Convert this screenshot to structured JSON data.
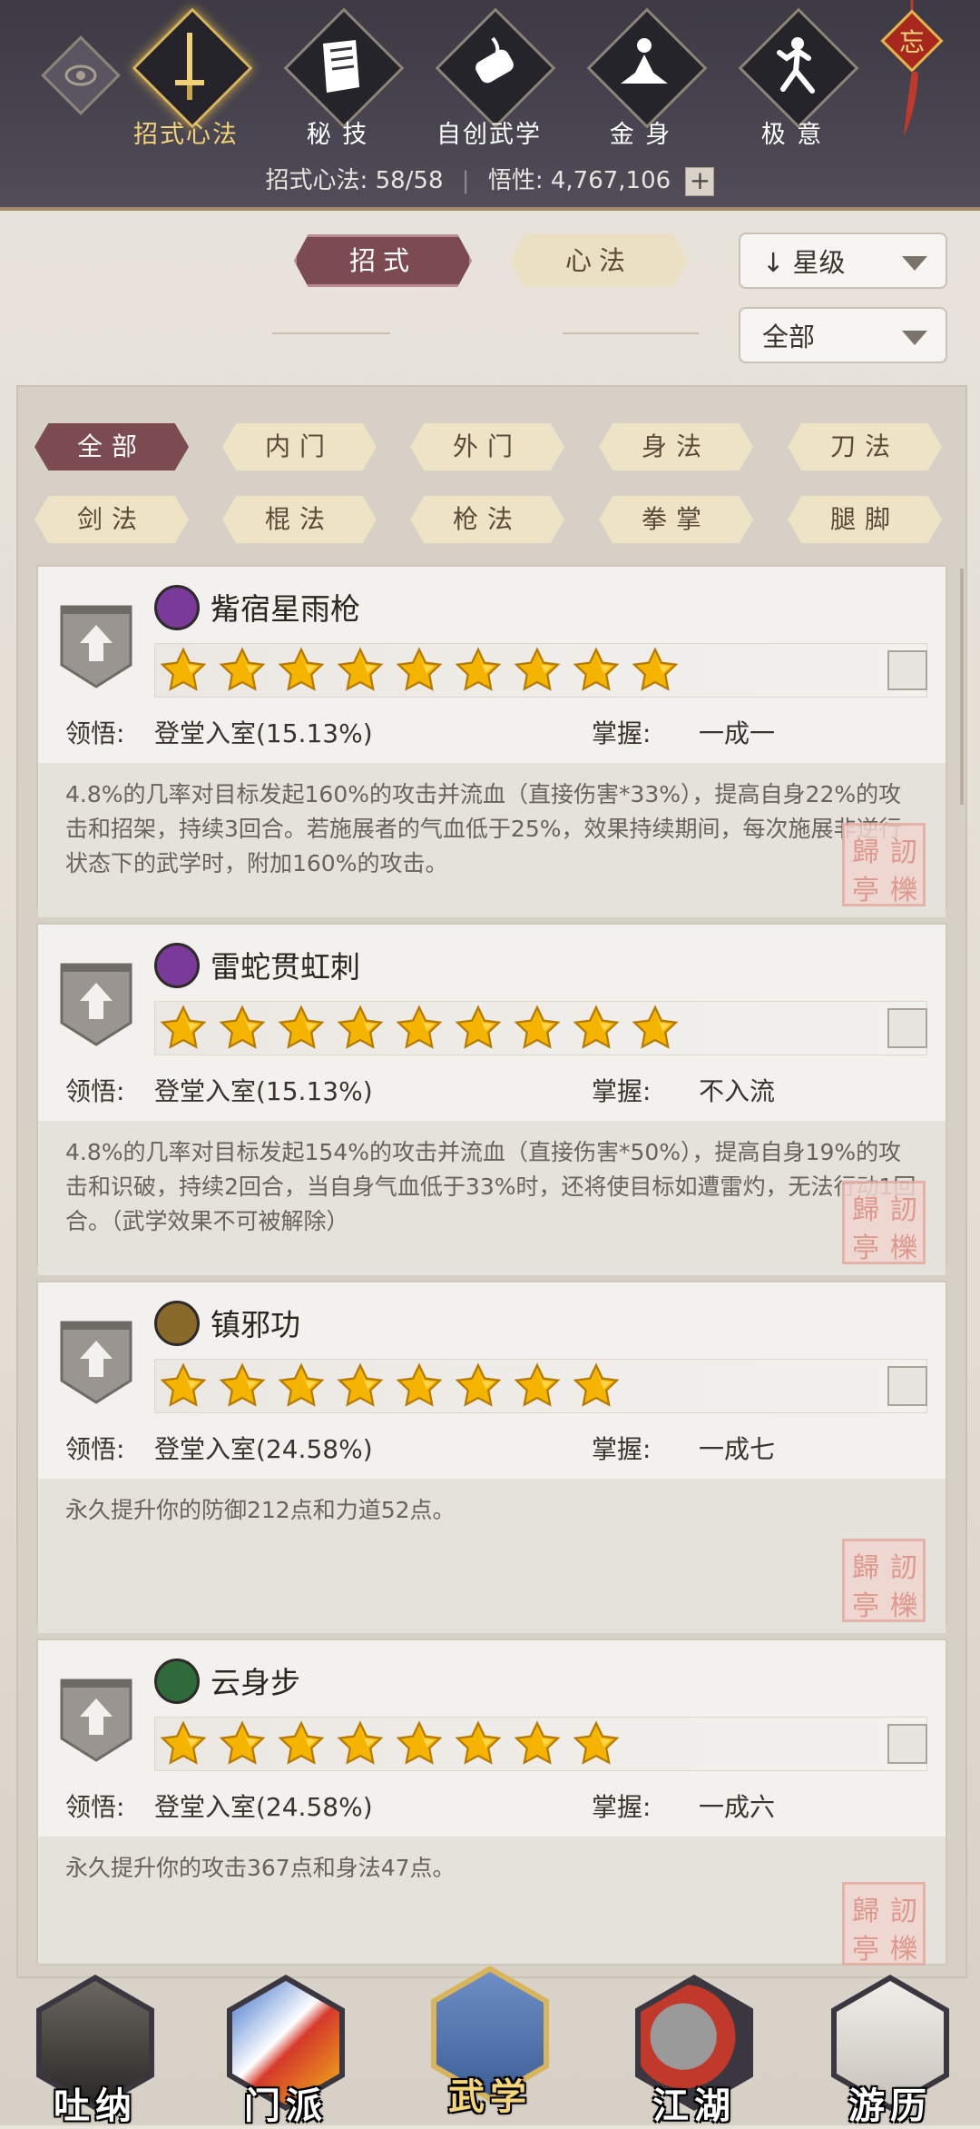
{
  "top_nav": {
    "items": [
      {
        "label": "招式心法",
        "icon": "sword-icon",
        "active": true
      },
      {
        "label": "秘 技",
        "icon": "book-icon",
        "active": false
      },
      {
        "label": "自创武学",
        "icon": "scroll-icon",
        "active": false
      },
      {
        "label": "金 身",
        "icon": "meditation-icon",
        "active": false
      },
      {
        "label": "极 意",
        "icon": "martial-pose-icon",
        "active": false
      }
    ],
    "charm_char": "忘"
  },
  "stats": {
    "skills_label": "招式心法:",
    "skills_value": "58/58",
    "insight_label": "悟性:",
    "insight_value": "4,767,106"
  },
  "tabs": {
    "moves": "招式",
    "methods": "心法"
  },
  "sort": {
    "order": "星级",
    "filter": "全部"
  },
  "categories": [
    "全部",
    "内门",
    "外门",
    "身法",
    "刀法",
    "剑法",
    "棍法",
    "枪法",
    "拳掌",
    "腿脚"
  ],
  "skills": [
    {
      "name": "觜宿星雨枪",
      "stars": 9,
      "insight_label": "领悟:",
      "insight_value": "登堂入室(15.13%)",
      "mastery_label": "掌握:",
      "mastery_value": "一成一",
      "desc": "4.8%的几率对目标发起160%的攻击并流血（直接伤害*33%），提高自身22%的攻击和招架，持续3回合。若施展者的气血低于25%，效果持续期间，每次施展非逆行状态下的武学时，附加160%的攻击。",
      "icon_color": "#7a3a9a",
      "type_icon": "spear-icon"
    },
    {
      "name": "雷蛇贯虹刺",
      "stars": 9,
      "insight_label": "领悟:",
      "insight_value": "登堂入室(15.13%)",
      "mastery_label": "掌握:",
      "mastery_value": "不入流",
      "desc": "4.8%的几率对目标发起154%的攻击并流血（直接伤害*50%），提高自身19%的攻击和识破，持续2回合，当自身气血低于33%时，还将使目标如遭雷灼，无法行动1回合。（武学效果不可被解除）",
      "icon_color": "#7a3a9a",
      "type_icon": "spear-icon"
    },
    {
      "name": "镇邪功",
      "stars": 8,
      "insight_label": "领悟:",
      "insight_value": "登堂入室(24.58%)",
      "mastery_label": "掌握:",
      "mastery_value": "一成七",
      "desc": "永久提升你的防御212点和力道52点。",
      "icon_color": "#8a6a2a",
      "type_icon": "inner-art-icon"
    },
    {
      "name": "云身步",
      "stars": 8,
      "insight_label": "领悟:",
      "insight_value": "登堂入室(24.58%)",
      "mastery_label": "掌握:",
      "mastery_value": "一成六",
      "desc": "永久提升你的攻击367点和身法47点。",
      "icon_color": "#2f6a3a",
      "type_icon": "footwork-icon"
    }
  ],
  "bottom_nav": [
    {
      "label": "吐纳",
      "active": false
    },
    {
      "label": "门派",
      "active": false
    },
    {
      "label": "武学",
      "active": true
    },
    {
      "label": "江湖",
      "active": false
    },
    {
      "label": "游历",
      "active": false
    }
  ],
  "seal_chars": [
    "歸",
    "訒",
    "亭",
    "櫟"
  ],
  "colors": {
    "accent": "#7c4b52",
    "star": "#f4b400",
    "topbar": "#3d3a44",
    "active_gold": "#f2d27a"
  }
}
